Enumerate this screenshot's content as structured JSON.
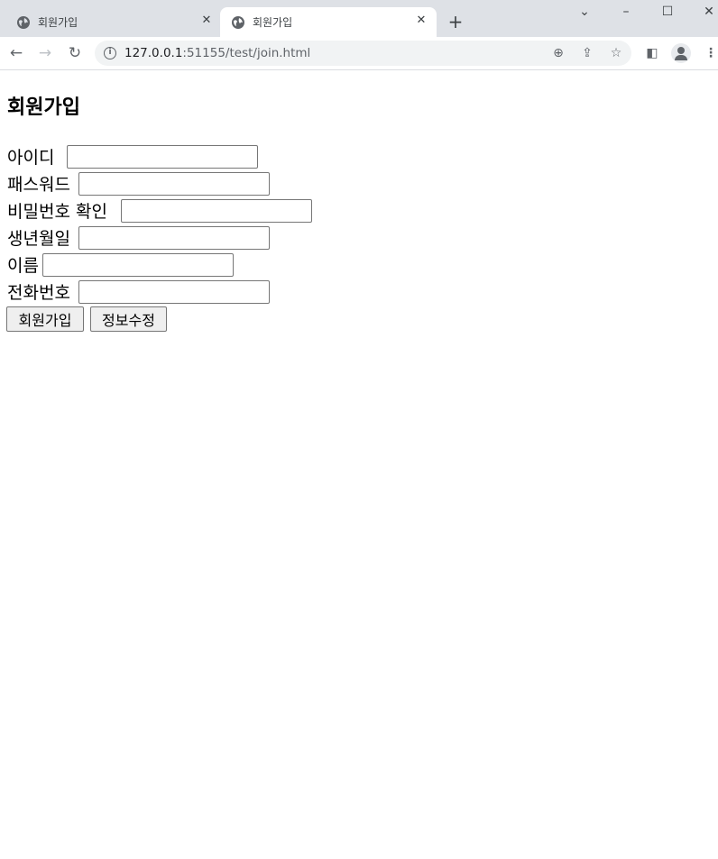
{
  "browser": {
    "tabs": [
      {
        "title": "회원가입",
        "active": false
      },
      {
        "title": "회원가입",
        "active": true
      }
    ],
    "url_host": "127.0.0.1",
    "url_rest": ":51155/test/join.html"
  },
  "page": {
    "heading": "회원가입",
    "fields": [
      {
        "label": "아이디 ",
        "value": ""
      },
      {
        "label": "패스워드",
        "value": ""
      },
      {
        "label": "비밀번호 확인",
        "value": ""
      },
      {
        "label": "생년월일",
        "value": ""
      },
      {
        "label": "이름",
        "value": ""
      },
      {
        "label": "전화번호",
        "value": ""
      }
    ],
    "buttons": {
      "join": "회원가입",
      "edit": "정보수정"
    }
  },
  "icons": {
    "tab_favicon": "globe-icon",
    "back": "arrow-left-icon",
    "forward": "arrow-right-icon",
    "reload": "reload-icon",
    "site_info": "info-icon",
    "zoom": "zoom-icon",
    "share": "share-icon",
    "bookmark": "star-icon",
    "side_panel": "side-panel-icon",
    "profile": "avatar-icon",
    "menu": "kebab-menu-icon"
  }
}
